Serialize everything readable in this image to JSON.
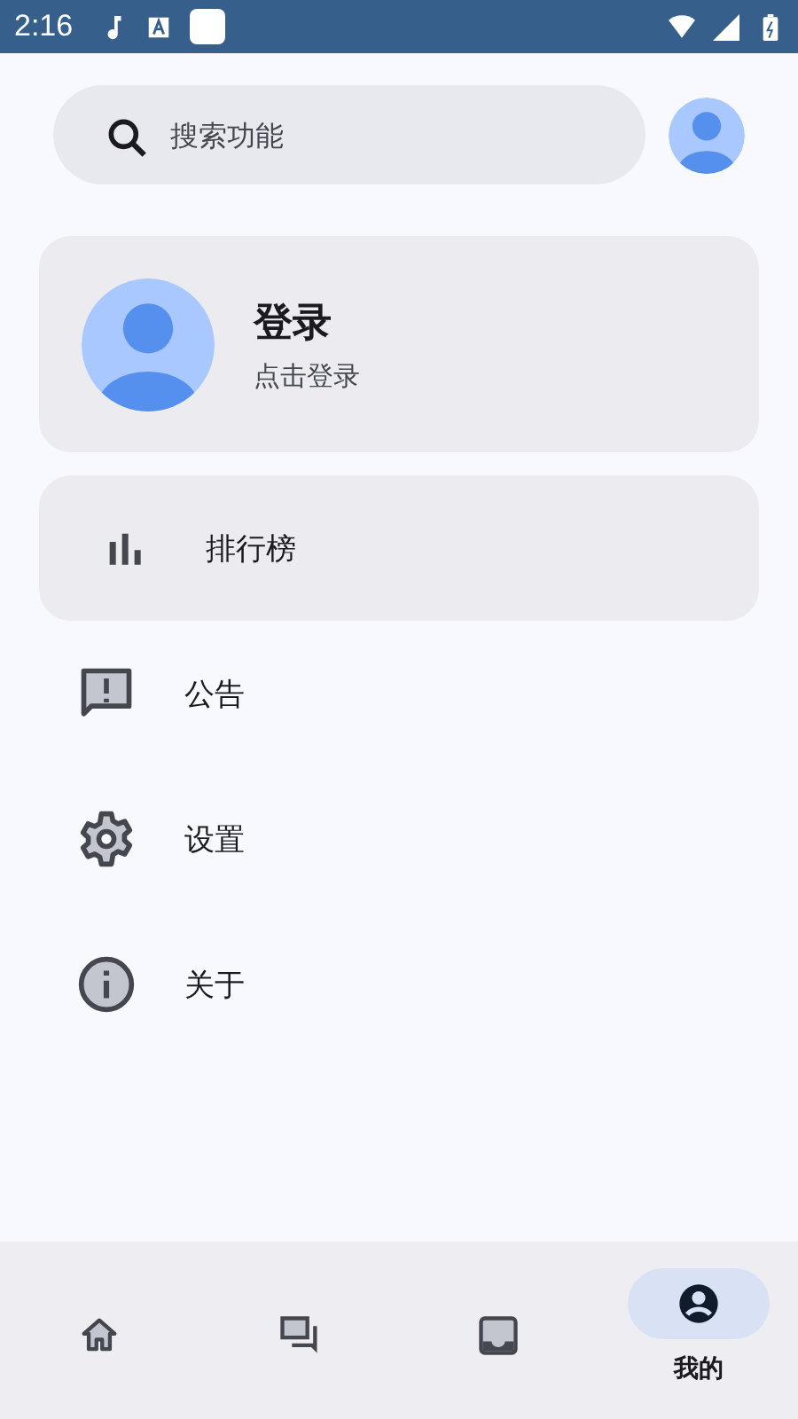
{
  "status_bar": {
    "time": "2:16"
  },
  "search": {
    "placeholder": "搜索功能"
  },
  "profile": {
    "name": "登录",
    "hint": "点击登录"
  },
  "menu": [
    {
      "kind": "card",
      "label": "排行榜"
    },
    {
      "kind": "row",
      "label": "公告"
    },
    {
      "kind": "row",
      "label": "设置"
    },
    {
      "kind": "row",
      "label": "关于"
    }
  ],
  "nav": [
    {
      "selected": false
    },
    {
      "selected": false
    },
    {
      "selected": false
    },
    {
      "label": "我的",
      "selected": true
    }
  ]
}
